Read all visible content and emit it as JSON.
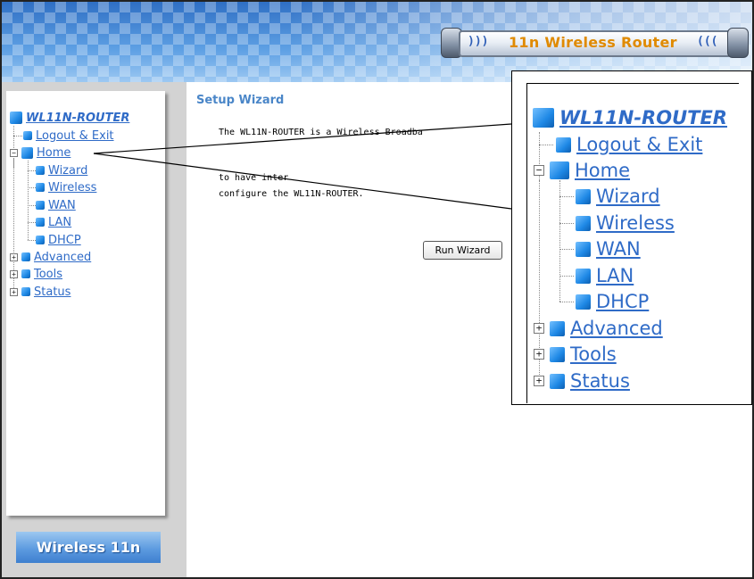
{
  "header": {
    "badge_title": "11n Wireless Router",
    "wave_left": ")))",
    "wave_right": "(((",
    "colors": {
      "banner_blue": "#4a90d9",
      "title_orange": "#e08a00"
    }
  },
  "sidebar": {
    "root": "WL11N-ROUTER",
    "items": [
      {
        "label": "Logout & Exit"
      },
      {
        "label": "Home"
      },
      {
        "label": "Wizard"
      },
      {
        "label": "Wireless"
      },
      {
        "label": "WAN"
      },
      {
        "label": "LAN"
      },
      {
        "label": "DHCP"
      },
      {
        "label": "Advanced"
      },
      {
        "label": "Tools"
      },
      {
        "label": "Status"
      }
    ],
    "footer_label": "Wireless 11n"
  },
  "main": {
    "title": "Setup Wizard",
    "text_lines": [
      "The WL11N-ROUTER is a Wireless Broadba",
      "to have inter",
      "configure the WL11N-ROUTER."
    ],
    "run_button": "Run Wizard"
  },
  "zoom": {
    "root": "WL11N-ROUTER",
    "items": [
      {
        "label": "Logout & Exit"
      },
      {
        "label": "Home"
      },
      {
        "label": "Wizard"
      },
      {
        "label": "Wireless"
      },
      {
        "label": "WAN"
      },
      {
        "label": "LAN"
      },
      {
        "label": "DHCP"
      },
      {
        "label": "Advanced"
      },
      {
        "label": "Tools"
      },
      {
        "label": "Status"
      }
    ]
  }
}
